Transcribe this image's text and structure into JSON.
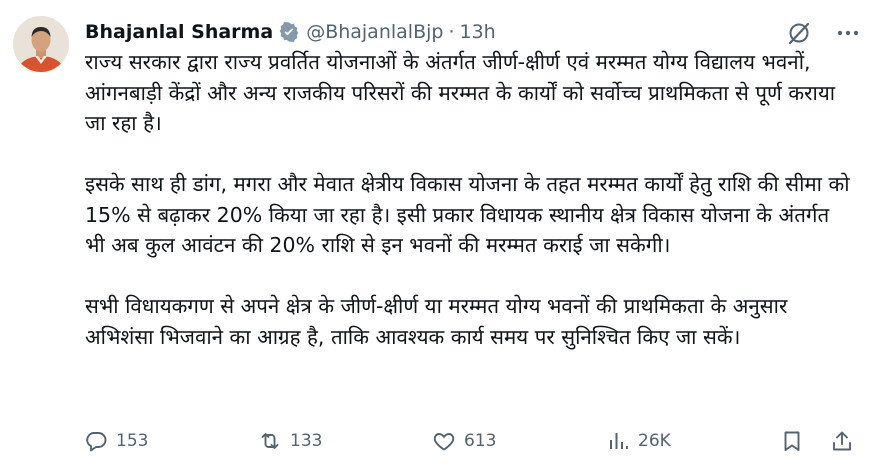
{
  "tweet": {
    "author_name": "Bhajanlal Sharma",
    "handle": "@BhajanlalBjp",
    "separator": "·",
    "time": "13h",
    "paragraphs": [
      "राज्य सरकार द्वारा राज्य प्रवर्तित योजनाओं के अंतर्गत जीर्ण-क्षीर्ण एवं मरम्मत योग्य विद्यालय भवनों, आंगनबाड़ी केंद्रों और अन्य राजकीय परिसरों की मरम्मत के कार्यों को सर्वोच्च प्राथमिकता से पूर्ण कराया जा रहा है।",
      "इसके साथ ही डांग, मगरा और मेवात क्षेत्रीय विकास योजना के तहत मरम्मत कार्यों हेतु राशि की सीमा को 15% से बढ़ाकर 20% किया जा रहा है। इसी प्रकार विधायक स्थानीय क्षेत्र विकास योजना के अंतर्गत भी अब कुल आवंटन की 20% राशि से इन भवनों की मरम्मत कराई जा सकेगी।",
      "सभी विधायकगण से अपने क्षेत्र के जीर्ण-क्षीर्ण या मरम्मत योग्य भवनों की प्राथमिकता के अनुसार अभिशंसा भिजवाने का आग्रह है, ताकि आवश्यक कार्य समय पर सुनिश्चित किए जा सकें।"
    ]
  },
  "actions": {
    "replies": "153",
    "reposts": "133",
    "likes": "613",
    "views": "26K"
  },
  "icons": {
    "verified": "verified-badge-icon",
    "grok": "grok-icon",
    "more": "more-options-icon",
    "reply": "reply-icon",
    "repost": "repost-icon",
    "like": "like-icon",
    "views": "views-icon",
    "bookmark": "bookmark-icon",
    "share": "share-icon"
  },
  "colors": {
    "text": "#0f1419",
    "secondary": "#536471",
    "background": "#ffffff"
  }
}
